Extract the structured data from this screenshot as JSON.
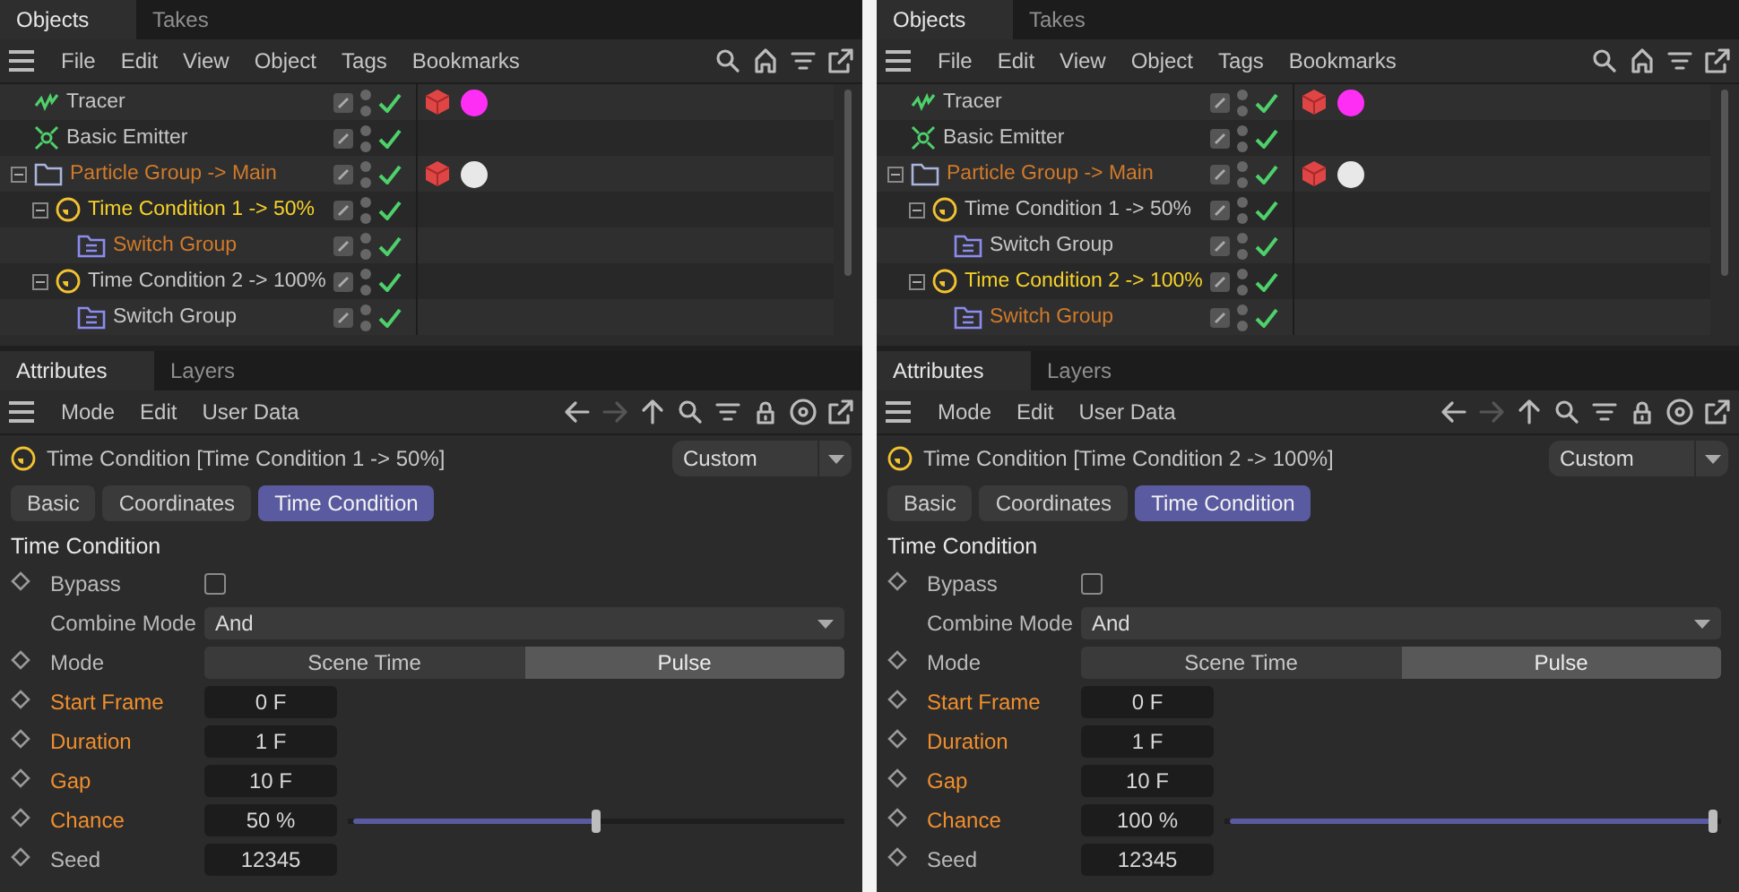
{
  "panels": [
    {
      "object_tabs": [
        {
          "label": "Objects",
          "selected": true
        },
        {
          "label": "Takes",
          "selected": false
        }
      ],
      "object_menu": [
        "File",
        "Edit",
        "View",
        "Object",
        "Tags",
        "Bookmarks"
      ],
      "tree": [
        {
          "name": "Tracer",
          "kind": "tracer",
          "selected": false,
          "highlighted": false,
          "tags": [
            {
              "kind": "cube"
            },
            {
              "kind": "material",
              "color": "#ff2ef5"
            }
          ]
        },
        {
          "name": "Basic Emitter",
          "kind": "emitter",
          "selected": false,
          "highlighted": false
        },
        {
          "name": "Particle Group -> Main",
          "kind": "group",
          "selected": false,
          "highlighted": true,
          "expanded": true,
          "tags": [
            {
              "kind": "cube"
            },
            {
              "kind": "material",
              "color": "#e8e8e8"
            }
          ],
          "children": [
            {
              "name": "Time Condition 1 -> 50%",
              "kind": "condition",
              "selected": true,
              "expanded": true,
              "children": [
                {
                  "name": "Switch Group",
                  "kind": "switch",
                  "selected": false,
                  "highlighted": true
                }
              ]
            },
            {
              "name": "Time Condition 2 -> 100%",
              "kind": "condition",
              "selected": false,
              "highlighted": false,
              "expanded": true,
              "children": [
                {
                  "name": "Switch Group",
                  "kind": "switch",
                  "selected": false,
                  "highlighted": false
                }
              ]
            }
          ]
        }
      ],
      "attribute_tabs": [
        {
          "label": "Attributes",
          "selected": true
        },
        {
          "label": "Layers",
          "selected": false
        }
      ],
      "attribute_menu": [
        "Mode",
        "Edit",
        "User Data"
      ],
      "header": {
        "title": "Time Condition [Time Condition 1 -> 50%]",
        "preset": "Custom"
      },
      "page_tabs": [
        {
          "label": "Basic",
          "selected": false
        },
        {
          "label": "Coordinates",
          "selected": false
        },
        {
          "label": "Time Condition",
          "selected": true
        }
      ],
      "section": "Time Condition",
      "params": [
        {
          "label": "Bypass",
          "kind": "checkbox",
          "keyframe": true,
          "animated": false,
          "checked": false
        },
        {
          "label": "Combine Mode",
          "kind": "dropdown",
          "keyframe": false,
          "animated": false,
          "value": "And"
        },
        {
          "label": "Mode",
          "kind": "segmented",
          "keyframe": true,
          "animated": false,
          "options": [
            {
              "label": "Scene Time",
              "selected": false
            },
            {
              "label": "Pulse",
              "selected": true
            }
          ]
        },
        {
          "label": "Start Frame",
          "kind": "number",
          "keyframe": true,
          "animated": true,
          "value": "0 F"
        },
        {
          "label": "Duration",
          "kind": "number",
          "keyframe": true,
          "animated": true,
          "value": "1 F"
        },
        {
          "label": "Gap",
          "kind": "number",
          "keyframe": true,
          "animated": true,
          "value": "10 F"
        },
        {
          "label": "Chance",
          "kind": "slider",
          "keyframe": true,
          "animated": true,
          "value": "50 %",
          "level": 0.5
        },
        {
          "label": "Seed",
          "kind": "number",
          "keyframe": true,
          "animated": false,
          "value": "12345"
        }
      ]
    },
    {
      "object_tabs": [
        {
          "label": "Objects",
          "selected": true
        },
        {
          "label": "Takes",
          "selected": false
        }
      ],
      "object_menu": [
        "File",
        "Edit",
        "View",
        "Object",
        "Tags",
        "Bookmarks"
      ],
      "tree": [
        {
          "name": "Tracer",
          "kind": "tracer",
          "selected": false,
          "highlighted": false,
          "tags": [
            {
              "kind": "cube"
            },
            {
              "kind": "material",
              "color": "#ff2ef5"
            }
          ]
        },
        {
          "name": "Basic Emitter",
          "kind": "emitter",
          "selected": false,
          "highlighted": false
        },
        {
          "name": "Particle Group -> Main",
          "kind": "group",
          "selected": false,
          "highlighted": true,
          "expanded": true,
          "tags": [
            {
              "kind": "cube"
            },
            {
              "kind": "material",
              "color": "#e8e8e8"
            }
          ],
          "children": [
            {
              "name": "Time Condition 1 -> 50%",
              "kind": "condition",
              "selected": false,
              "highlighted": false,
              "expanded": true,
              "children": [
                {
                  "name": "Switch Group",
                  "kind": "switch",
                  "selected": false,
                  "highlighted": false
                }
              ]
            },
            {
              "name": "Time Condition 2 -> 100%",
              "kind": "condition",
              "selected": true,
              "expanded": true,
              "children": [
                {
                  "name": "Switch Group",
                  "kind": "switch",
                  "selected": false,
                  "highlighted": true
                }
              ]
            }
          ]
        }
      ],
      "attribute_tabs": [
        {
          "label": "Attributes",
          "selected": true
        },
        {
          "label": "Layers",
          "selected": false
        }
      ],
      "attribute_menu": [
        "Mode",
        "Edit",
        "User Data"
      ],
      "header": {
        "title": "Time Condition [Time Condition 2 -> 100%]",
        "preset": "Custom"
      },
      "page_tabs": [
        {
          "label": "Basic",
          "selected": false
        },
        {
          "label": "Coordinates",
          "selected": false
        },
        {
          "label": "Time Condition",
          "selected": true
        }
      ],
      "section": "Time Condition",
      "params": [
        {
          "label": "Bypass",
          "kind": "checkbox",
          "keyframe": true,
          "animated": false,
          "checked": false
        },
        {
          "label": "Combine Mode",
          "kind": "dropdown",
          "keyframe": false,
          "animated": false,
          "value": "And"
        },
        {
          "label": "Mode",
          "kind": "segmented",
          "keyframe": true,
          "animated": false,
          "options": [
            {
              "label": "Scene Time",
              "selected": false
            },
            {
              "label": "Pulse",
              "selected": true
            }
          ]
        },
        {
          "label": "Start Frame",
          "kind": "number",
          "keyframe": true,
          "animated": true,
          "value": "0 F"
        },
        {
          "label": "Duration",
          "kind": "number",
          "keyframe": true,
          "animated": true,
          "value": "1 F"
        },
        {
          "label": "Gap",
          "kind": "number",
          "keyframe": true,
          "animated": true,
          "value": "10 F"
        },
        {
          "label": "Chance",
          "kind": "slider",
          "keyframe": true,
          "animated": true,
          "value": "100 %",
          "level": 1
        },
        {
          "label": "Seed",
          "kind": "number",
          "keyframe": true,
          "animated": false,
          "value": "12345"
        }
      ]
    }
  ]
}
